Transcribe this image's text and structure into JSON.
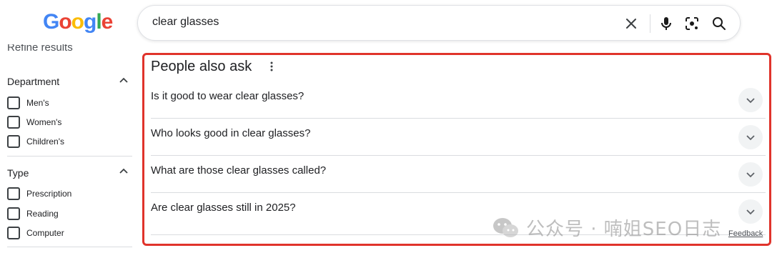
{
  "header": {
    "logo_text": "Google",
    "search_value": "clear glasses"
  },
  "sidebar": {
    "title": "Refine results",
    "sections": [
      {
        "title": "Department",
        "items": [
          "Men's",
          "Women's",
          "Children's"
        ]
      },
      {
        "title": "Type",
        "items": [
          "Prescription",
          "Reading",
          "Computer"
        ]
      }
    ]
  },
  "paa": {
    "title": "People also ask",
    "questions": [
      "Is it good to wear clear glasses?",
      "Who looks good in clear glasses?",
      "What are those clear glasses called?",
      "Are clear glasses still in 2025?"
    ],
    "feedback": "Feedback"
  },
  "watermark": {
    "text": "公众号 · 喃姐SEO日志"
  },
  "colors": {
    "highlight_border": "#e0332b"
  },
  "icons": [
    "clear-icon",
    "mic-icon",
    "lens-icon",
    "search-icon",
    "more-vert-icon",
    "chevron-down-icon",
    "chevron-up-icon",
    "wechat-icon"
  ]
}
